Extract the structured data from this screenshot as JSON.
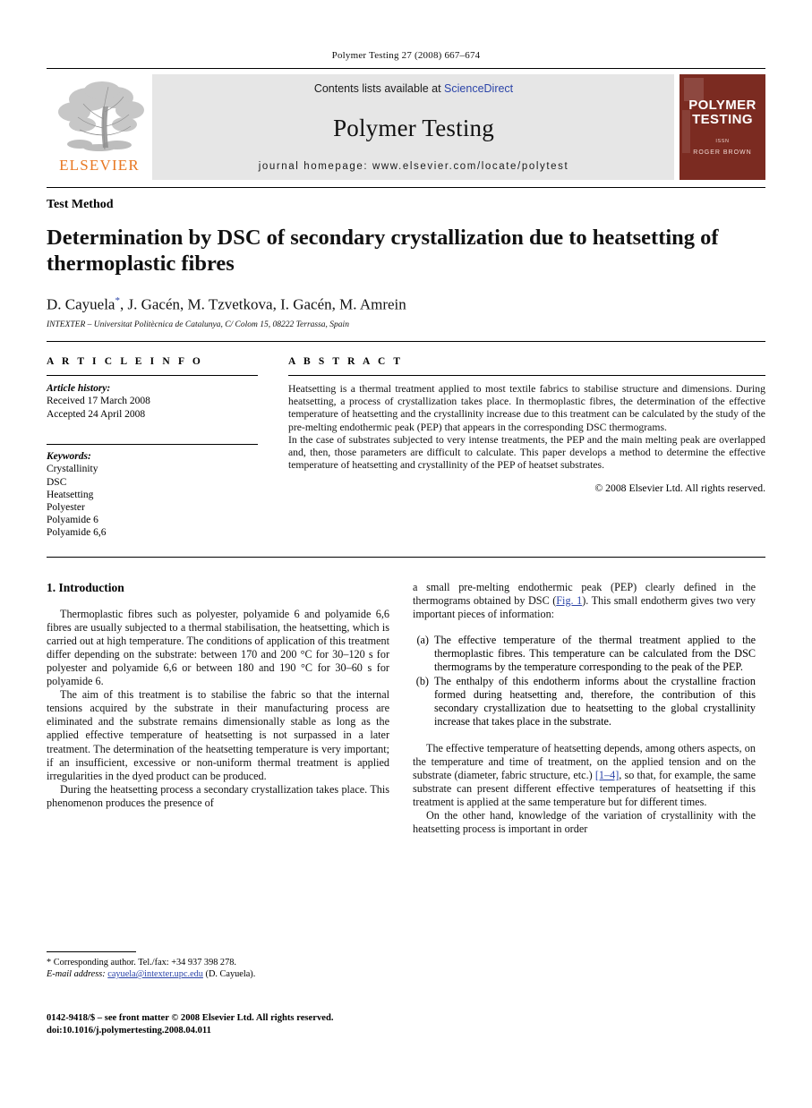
{
  "running_head": "Polymer Testing 27 (2008) 667–674",
  "banner": {
    "contents_prefix": "Contents lists available at ",
    "contents_link": "ScienceDirect",
    "journal_title": "Polymer Testing",
    "homepage": "journal homepage: www.elsevier.com/locate/polytest",
    "publisher_logo_word": "ELSEVIER",
    "cover": {
      "title_line1": "POLYMER",
      "title_line2": "TESTING",
      "subtitle": "ISSN",
      "author": "ROGER BROWN"
    },
    "colors": {
      "link": "#2B44A8",
      "elsevier_orange": "#E87722",
      "cover_bg": "#7B2B21",
      "banner_bg": "#e6e6e6"
    }
  },
  "article": {
    "doctype": "Test Method",
    "title": "Determination by DSC of secondary crystallization due to heatsetting of thermoplastic fibres",
    "authors": "D. Cayuela",
    "authors_sup": "*",
    "authors_rest": ", J. Gacén, M. Tzvetkova, I. Gacén, M. Amrein",
    "affiliation": "INTEXTER – Universitat Politècnica de Catalunya, C/ Colom 15, 08222 Terrassa, Spain"
  },
  "article_info": {
    "heading": "A R T I C L E  I N F O",
    "history_label": "Article history:",
    "received": "Received 17 March 2008",
    "accepted": "Accepted 24 April 2008",
    "keywords_label": "Keywords:",
    "keywords": [
      "Crystallinity",
      "DSC",
      "Heatsetting",
      "Polyester",
      "Polyamide 6",
      "Polyamide 6,6"
    ]
  },
  "abstract": {
    "heading": "A B S T R A C T",
    "paragraph1": "Heatsetting is a thermal treatment applied to most textile fabrics to stabilise structure and dimensions. During heatsetting, a process of crystallization takes place. In thermoplastic fibres, the determination of the effective temperature of heatsetting and the crystallinity increase due to this treatment can be calculated by the study of the pre-melting endothermic peak (PEP) that appears in the corresponding DSC thermograms.",
    "paragraph2": "In the case of substrates subjected to very intense treatments, the PEP and the main melting peak are overlapped and, then, those parameters are difficult to calculate. This paper develops a method to determine the effective temperature of heatsetting and crystallinity of the PEP of heatset substrates.",
    "copyright": "© 2008 Elsevier Ltd. All rights reserved."
  },
  "body": {
    "section_number_title": "1. Introduction",
    "left_paragraphs": [
      "Thermoplastic fibres such as polyester, polyamide 6 and polyamide 6,6 fibres are usually subjected to a thermal stabilisation, the heatsetting, which is carried out at high temperature. The conditions of application of this treatment differ depending on the substrate: between 170 and 200 °C for 30–120 s for polyester and polyamide 6,6 or between 180 and 190 °C for 30–60 s for polyamide 6.",
      "The aim of this treatment is to stabilise the fabric so that the internal tensions acquired by the substrate in their manufacturing process are eliminated and the substrate remains dimensionally stable as long as the applied effective temperature of heatsetting is not surpassed in a later treatment. The determination of the heatsetting temperature is very important; if an insufficient, excessive or non-uniform thermal treatment is applied irregularities in the dyed product can be produced.",
      "During the heatsetting process a secondary crystallization takes place. This phenomenon produces the presence of"
    ],
    "right_intro_pre": "a small pre-melting endothermic peak (PEP) clearly defined in the thermograms obtained by DSC (",
    "right_intro_link": "Fig. 1",
    "right_intro_post": "). This small endotherm gives two very important pieces of information:",
    "list_items": [
      {
        "marker": "(a)",
        "text": "The effective temperature of the thermal treatment applied to the thermoplastic fibres. This temperature can be calculated from the DSC thermograms by the temperature corresponding to the peak of the PEP."
      },
      {
        "marker": "(b)",
        "text": "The enthalpy of this endotherm informs about the crystalline fraction formed during heatsetting and, therefore, the contribution of this secondary crystallization due to heatsetting to the global crystallinity increase that takes place in the substrate."
      }
    ],
    "right_para_pre": "The effective temperature of heatsetting depends, among others aspects, on the temperature and time of treatment, on the applied tension and on the substrate (diameter, fabric structure, etc.) ",
    "right_para_link": "[1–4]",
    "right_para_post": ", so that, for example, the same substrate can present different effective temperatures of heatsetting if this treatment is applied at the same temperature but for different times.",
    "right_last_para": "On the other hand, knowledge of the variation of crystallinity with the heatsetting process is important in order"
  },
  "footnotes": {
    "corresponding": "* Corresponding author. Tel./fax: +34 937 398 278.",
    "email_label": "E-mail address:",
    "email": "cayuela@intexter.upc.edu",
    "email_suffix": " (D. Cayuela).",
    "issn_line": "0142-9418/$ – see front matter © 2008 Elsevier Ltd. All rights reserved.",
    "doi_line": "doi:10.1016/j.polymertesting.2008.04.011"
  }
}
